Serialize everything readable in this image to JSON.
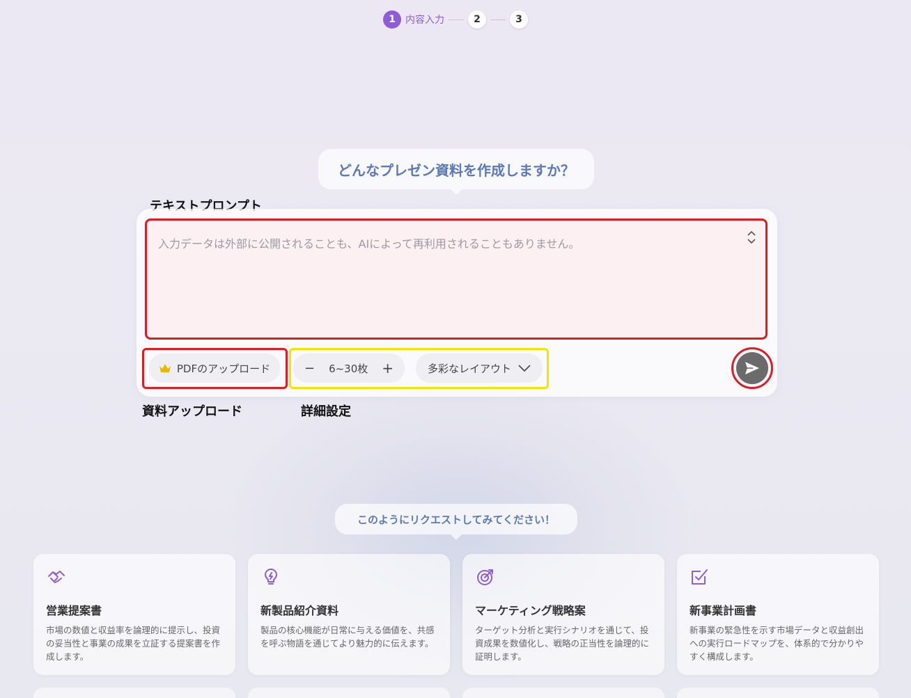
{
  "stepper": {
    "steps": [
      {
        "number": "1",
        "label": "内容入力"
      },
      {
        "number": "2"
      },
      {
        "number": "3"
      }
    ]
  },
  "headline": "どんなプレゼン資料を作成しますか？",
  "annotations": {
    "prompt": "テキストプロンプト",
    "upload": "資料アップロード",
    "detail": "詳細設定"
  },
  "prompt": {
    "placeholder": "入力データは外部に公開されることも、AIによって再利用されることもありません。"
  },
  "toolbar": {
    "upload_label": "PDFのアップロード",
    "count_label": "6~30枚",
    "minus_symbol": "−",
    "plus_symbol": "+",
    "layout_label": "多彩なレイアウト"
  },
  "examples_heading": "このようにリクエストしてみてください！",
  "examples": [
    {
      "icon": "handshake-icon",
      "title": "営業提案書",
      "description": "市場の数値と収益率を論理的に提示し、投資の妥当性と事業の成果を立証する提案書を作成します。"
    },
    {
      "icon": "lightbulb-icon",
      "title": "新製品紹介資料",
      "description": "製品の核心機能が日常に与える価値を、共感を呼ぶ物語を通じてより魅力的に伝えます。"
    },
    {
      "icon": "target-icon",
      "title": "マーケティング戦略案",
      "description": "ターゲット分析と実行シナリオを通じて、投資成果を数値化し、戦略の正当性を論理的に証明します。"
    },
    {
      "icon": "checklist-icon",
      "title": "新事業計画書",
      "description": "新事業の緊急性を示す市場データと収益創出への実行ロードマップを、体系的で分かりやすく構成します。"
    }
  ],
  "colors": {
    "accent": "#8f5cd6",
    "highlight_red": "#e01b24",
    "highlight_yellow": "#f2e600",
    "bubble_text": "#5b79b8"
  }
}
